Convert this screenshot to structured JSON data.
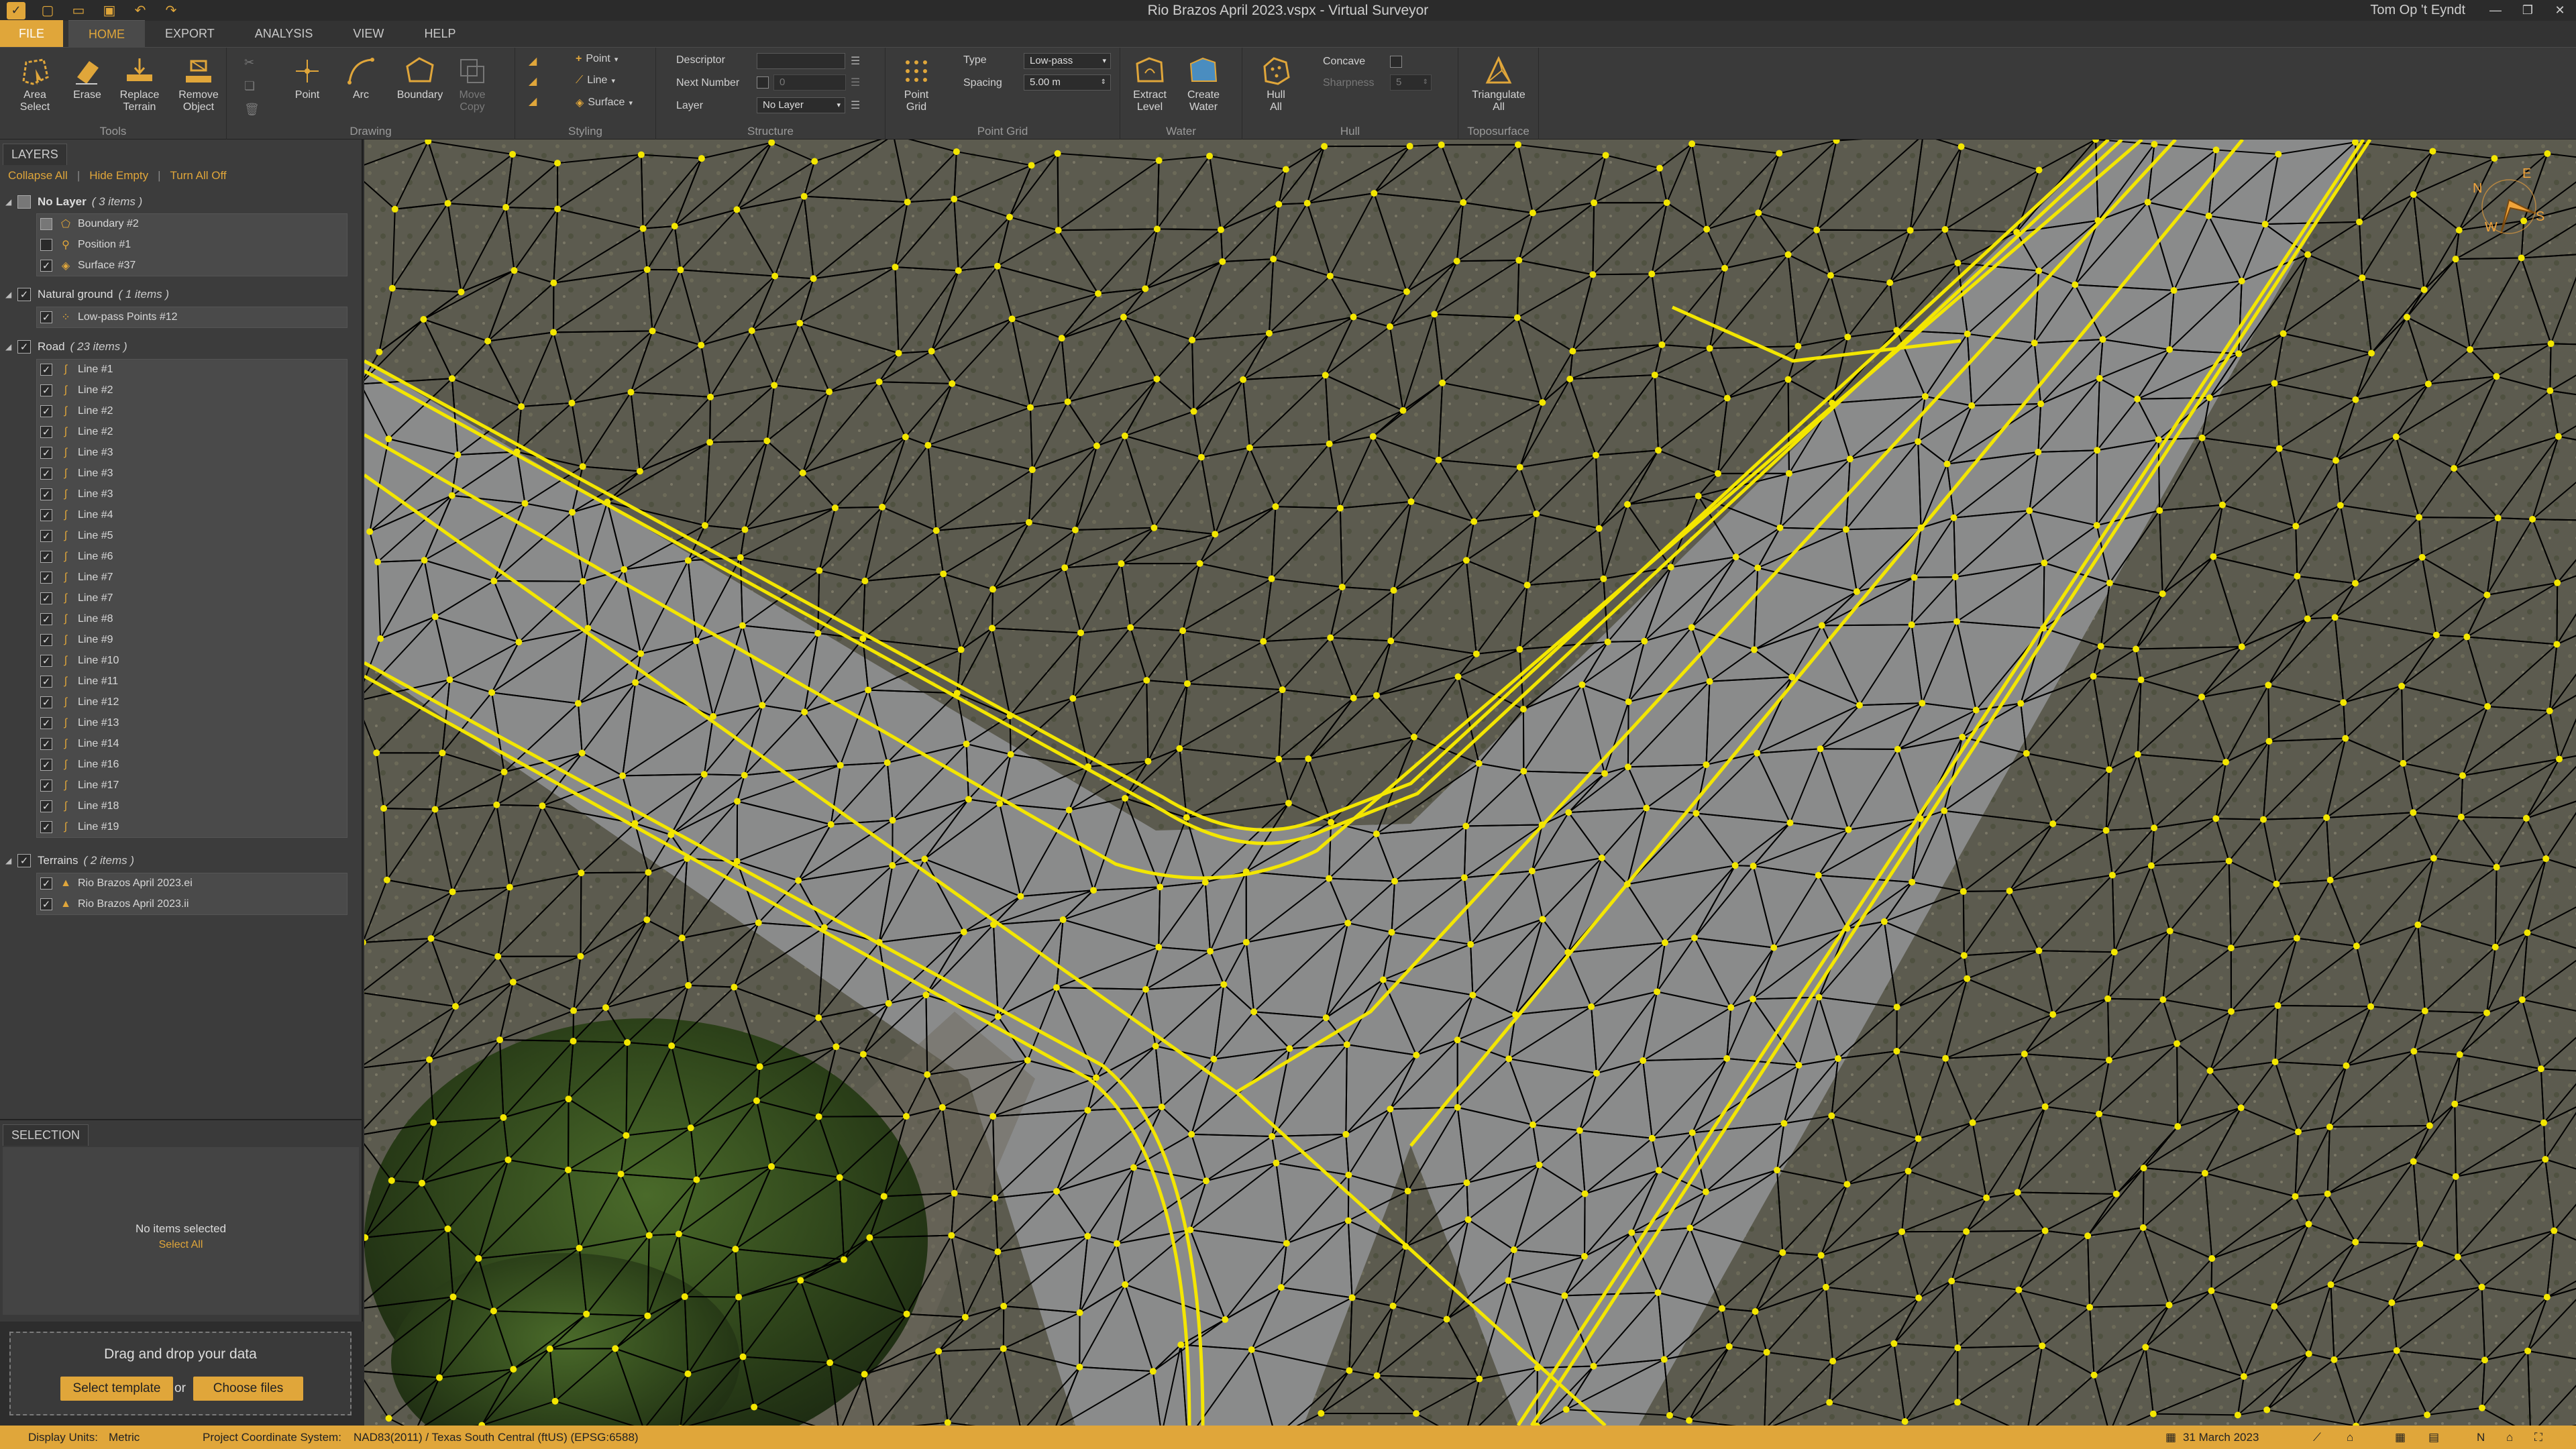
{
  "window": {
    "title": "Rio Brazos April 2023.vspx  -  Virtual Surveyor",
    "user": "Tom Op 't Eyndt"
  },
  "menu_tabs": [
    "FILE",
    "HOME",
    "EXPORT",
    "ANALYSIS",
    "VIEW",
    "HELP"
  ],
  "ribbon": {
    "tools": {
      "label": "Tools",
      "area_select": "Area\nSelect",
      "erase": "Erase",
      "replace_terrain": "Replace\nTerrain",
      "remove_object": "Remove\nObject"
    },
    "drawing": {
      "label": "Drawing",
      "point": "Point",
      "arc": "Arc",
      "boundary": "Boundary",
      "move_copy": "Move\nCopy"
    },
    "styling": {
      "label": "Styling",
      "point": "Point",
      "line": "Line",
      "surface": "Surface"
    },
    "structure": {
      "label": "Structure",
      "descriptor": "Descriptor",
      "next_number": "Next Number",
      "next_number_value": "0",
      "layer": "Layer",
      "layer_value": "No Layer"
    },
    "point_grid": {
      "label": "Point Grid",
      "button": "Point\nGrid",
      "type": "Type",
      "type_value": "Low-pass",
      "spacing": "Spacing",
      "spacing_value": "5.00 m"
    },
    "water": {
      "label": "Water",
      "extract_level": "Extract\nLevel",
      "create_water": "Create\nWater"
    },
    "hull": {
      "label": "Hull",
      "hull_all": "Hull\nAll",
      "concave": "Concave",
      "sharpness": "Sharpness",
      "sharpness_value": "5"
    },
    "toposurface": {
      "label": "Toposurface",
      "triangulate_all": "Triangulate\nAll"
    }
  },
  "layers_panel": {
    "tab": "LAYERS",
    "actions": {
      "collapse_all": "Collapse All",
      "hide_empty": "Hide Empty",
      "turn_all_off": "Turn All Off"
    },
    "groups": [
      {
        "name": "No Layer",
        "count": "( 3 items )",
        "items": [
          "Boundary #2",
          "Position #1",
          "Surface #37"
        ]
      },
      {
        "name": "Natural ground",
        "count": "( 1 items )",
        "items": [
          "Low-pass Points #12"
        ]
      },
      {
        "name": "Road",
        "count": "( 23 items )",
        "items": [
          "Line #1",
          "Line #2",
          "Line #2",
          "Line #2",
          "Line #3",
          "Line #3",
          "Line #3",
          "Line #4",
          "Line #5",
          "Line #6",
          "Line #7",
          "Line #7",
          "Line #8",
          "Line #9",
          "Line #10",
          "Line #11",
          "Line #12",
          "Line #13",
          "Line #14",
          "Line #16",
          "Line #17",
          "Line #18",
          "Line #19"
        ]
      },
      {
        "name": "Terrains",
        "count": "( 2 items )",
        "items": [
          "Rio Brazos April 2023.ei",
          "Rio Brazos April 2023.ii"
        ]
      }
    ]
  },
  "selection_panel": {
    "tab": "SELECTION",
    "empty_text": "No items selected",
    "select_all": "Select All"
  },
  "dropzone": {
    "text": "Drag and drop your data",
    "select_template": "Select template",
    "or": "or",
    "choose_files": "Choose files"
  },
  "viewport": {
    "compass": {
      "n": "N",
      "e": "E",
      "s": "S",
      "w": "W"
    }
  },
  "statusbar": {
    "display_units_label": "Display Units:",
    "display_units_value": "Metric",
    "crs_label": "Project Coordinate System:",
    "crs_value": "NAD83(2011) / Texas South Central (ftUS) (EPSG:6588)",
    "date": "31 March 2023"
  },
  "colors": {
    "accent": "#e0a63a",
    "breakline": "#f3e600",
    "mesh": "#000000",
    "road": "#8c8d8e"
  }
}
